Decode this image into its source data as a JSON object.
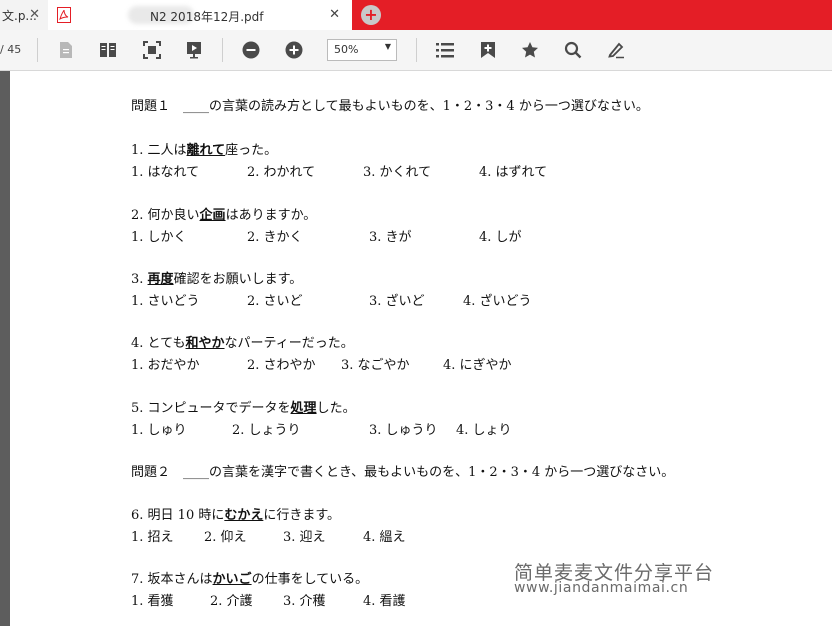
{
  "tabs": {
    "prev_title": "文.p...",
    "active_title": "N2 2018年12月.pdf"
  },
  "toolbar": {
    "page_count": "/ 45",
    "zoom_value": "50%",
    "icons": [
      "page-icon",
      "two-page-icon",
      "fit-screen-icon",
      "presentation-icon",
      "zoom-out-icon",
      "zoom-in-icon",
      "outline-list-icon",
      "add-bookmark-icon",
      "star-icon",
      "search-icon",
      "annotate-pen-icon"
    ]
  },
  "doc": {
    "q1_header": "問題１　____の言葉の読み方として最もよいものを、1・2・3・4 から一つ選びなさい。",
    "items": [
      {
        "pre": "1. 二人は",
        "bold": "離れて",
        "post": "座った。",
        "opts": [
          "1. はなれて",
          "2. わかれて",
          "3. かくれて",
          "4. はずれて"
        ]
      },
      {
        "pre": "2. 何か良い",
        "bold": "企画",
        "post": "はありますか。",
        "opts": [
          "1. しかく",
          "2. きかく",
          "3. きが",
          "4. しが"
        ]
      },
      {
        "pre": "3. ",
        "bold": "再度",
        "post": "確認をお願いします。",
        "opts": [
          "1. さいどう",
          "2. さいど",
          "3. ざいど",
          "4. ざいどう"
        ]
      },
      {
        "pre": "4. とても",
        "bold": "和やか",
        "post": "なパーティーだった。",
        "opts": [
          "1. おだやか",
          "2. さわやか",
          "3. なごやか",
          "4. にぎやか"
        ]
      },
      {
        "pre": "5. コンピュータでデータを",
        "bold": "処理",
        "post": "した。",
        "opts": [
          "1. しゅり",
          "2. しょうり",
          "3. しゅうり",
          "4. しょり"
        ]
      }
    ],
    "q2_header": "問題２　____の言葉を漢字で書くとき、最もよいものを、1・2・3・4 から一つ選びなさい。",
    "items2": [
      {
        "pre": "6. 明日 10 時に",
        "bold": "むかえ",
        "post": "に行きます。",
        "opts": [
          "1. 招え",
          "2. 仰え",
          "3. 迎え",
          "4. 縕え"
        ]
      },
      {
        "pre": "7. 坂本さんは",
        "bold": "かいご",
        "post": "の仕事をしている。",
        "opts": [
          "1. 看獲",
          "2. 介護",
          "3. 介穫",
          "4. 看護"
        ]
      }
    ]
  },
  "watermark": {
    "line1": "简单麦麦文件分享平台",
    "line2": "www.jiandanmaimai.cn"
  },
  "colors": {
    "tabbar": "#e41e26",
    "toolbar": "#f5f5f5",
    "icon": "#4a4a4a"
  }
}
